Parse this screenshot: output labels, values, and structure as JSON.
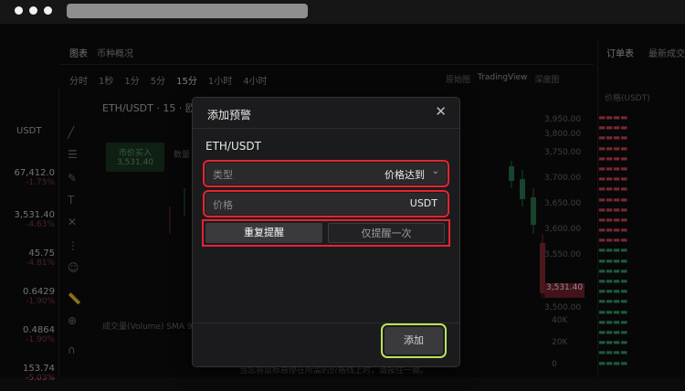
{
  "app": {
    "tabs": [
      "图表",
      "币种概况"
    ],
    "intervals": [
      "分时",
      "1秒",
      "1分",
      "5分",
      "15分",
      "1小时",
      "4小时"
    ],
    "active_interval": "15分",
    "chart_types": [
      "原始图",
      "TradingView",
      "深度图"
    ],
    "symbol_header": "ETH/USDT · 15 · 欧",
    "right_tabs": [
      "订单表",
      "最新成交"
    ],
    "orderbook_header": "价格(USDT)",
    "left_quote": "USDT",
    "left_prices": [
      "67,412.0",
      "3,531.40",
      "45.75",
      "0.6429",
      "0.4864",
      "153.74"
    ],
    "left_changes": [
      "-1.75%",
      "-4.63%",
      "-4.81%",
      "-1.90%",
      "-1.90%",
      "-5.03%"
    ],
    "price_ticks": [
      "3,950.00",
      "3,800.00",
      "3,750.00",
      "3,700.00",
      "3,650.00",
      "3,600.00",
      "3,550.00",
      "3,500.00"
    ],
    "last_price_tag": "3,531.40",
    "volume_label": "成交量(Volume) SMA 9",
    "vol_ticks": [
      "40K",
      "20K",
      "0"
    ],
    "market_buy": "市价买入",
    "market_buy_price": "3,531.40",
    "qty_label": "数量",
    "footer_text": "当您将鼠标悬停在所需的价格线上时，请按住一键。"
  },
  "modal": {
    "title": "添加预警",
    "close_icon": "close-icon",
    "pair": "ETH/USDT",
    "type_label": "类型",
    "type_value": "价格达到",
    "price_label": "价格",
    "price_unit": "USDT",
    "repeat_label": "重复提醒",
    "once_label": "仅提醒一次",
    "add_label": "添加"
  },
  "colors": {
    "highlight_red": "#e4242f",
    "highlight_green": "#b9e45a",
    "down_red": "#d94a5a",
    "up_green": "#38a56b"
  }
}
